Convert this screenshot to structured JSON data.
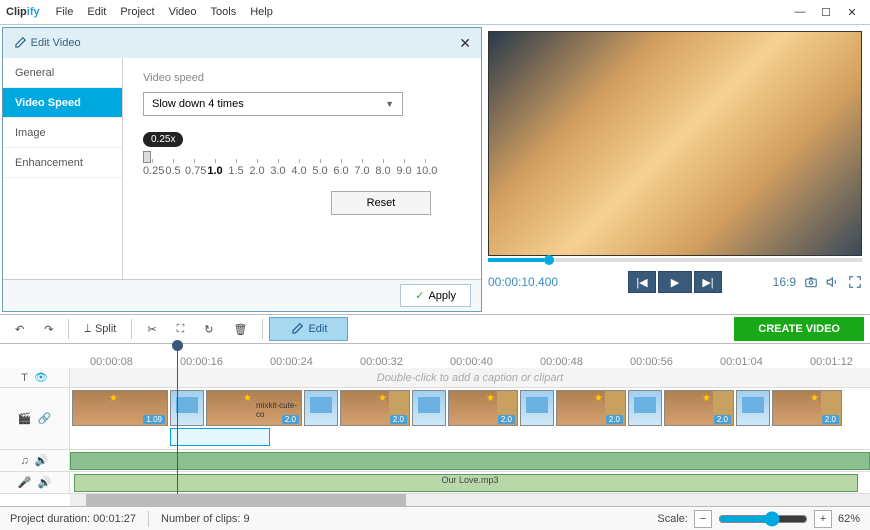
{
  "app": {
    "name_a": "Clip",
    "name_b": "ify"
  },
  "menu": [
    "File",
    "Edit",
    "Project",
    "Video",
    "Tools",
    "Help"
  ],
  "editPanel": {
    "title": "Edit Video",
    "tabs": [
      "General",
      "Video Speed",
      "Image",
      "Enhancement"
    ],
    "activeTab": 1,
    "speedLabel": "Video speed",
    "speedValue": "Slow down 4 times",
    "bubble": "0.25x",
    "scale": [
      "0.25",
      "0.5",
      "0.75",
      "1.0",
      "1.5",
      "2.0",
      "3.0",
      "4.0",
      "5.0",
      "6.0",
      "7.0",
      "8.0",
      "9.0",
      "10.0"
    ],
    "reset": "Reset",
    "apply": "Apply"
  },
  "preview": {
    "time": "00:00:10.400",
    "ratio": "16:9"
  },
  "toolbar": {
    "split": "Split",
    "edit": "Edit",
    "create": "CREATE VIDEO"
  },
  "ruler": [
    "00:00:08",
    "00:00:16",
    "00:00:24",
    "00:00:32",
    "00:00:40",
    "00:00:48",
    "00:00:56",
    "00:01:04",
    "00:01:12"
  ],
  "captionHint": "Double-click to add a caption or clipart",
  "clips": {
    "c1_tag": "1.09",
    "c2_name": "mixkit-cute-co",
    "c_tag": "2.0"
  },
  "audioName": "Our Love.mp3",
  "status": {
    "durLabel": "Project duration:",
    "durVal": "00:01:27",
    "clipsLabel": "Number of clips:",
    "clipsVal": "9",
    "scaleLabel": "Scale:",
    "scaleVal": "62%"
  }
}
